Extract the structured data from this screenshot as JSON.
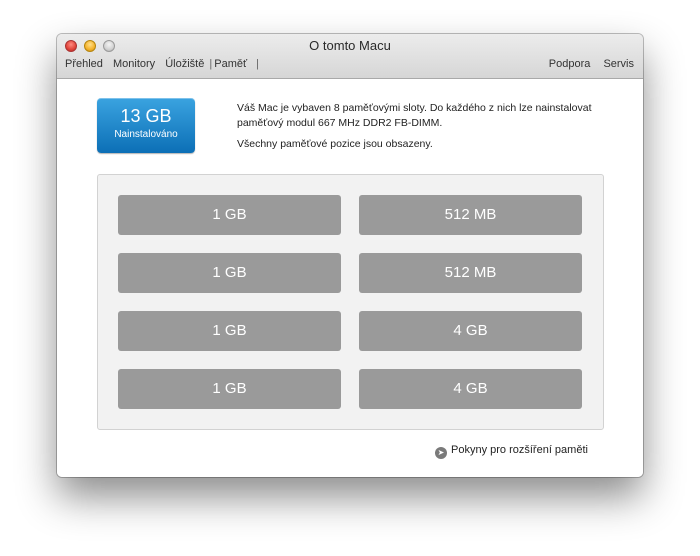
{
  "window": {
    "title": "O tomto Macu"
  },
  "nav": {
    "left": [
      "Přehled",
      "Monitory",
      "Úložiště",
      "Paměť"
    ],
    "active": "Paměť",
    "right": [
      "Podpora",
      "Servis"
    ]
  },
  "memory": {
    "installed_size": "13 GB",
    "installed_label": "Nainstalováno",
    "description": "Váš Mac je vybaven 8 paměťovými sloty. Do každého z nich lze nainstalovat paměťový modul 667 MHz DDR2 FB-DIMM.",
    "status": "Všechny paměťové pozice jsou obsazeny.",
    "slots": [
      {
        "left": "1 GB",
        "right": "512 MB"
      },
      {
        "left": "1 GB",
        "right": "512 MB"
      },
      {
        "left": "1 GB",
        "right": "4 GB"
      },
      {
        "left": "1 GB",
        "right": "4 GB"
      }
    ],
    "upgrade_link": "Pokyny pro rozšíření paměti"
  },
  "colors": {
    "badge": "#1a84c8",
    "slot": "#9a9a9a"
  },
  "icons": {
    "upgrade_link": "arrow-circle-icon"
  }
}
